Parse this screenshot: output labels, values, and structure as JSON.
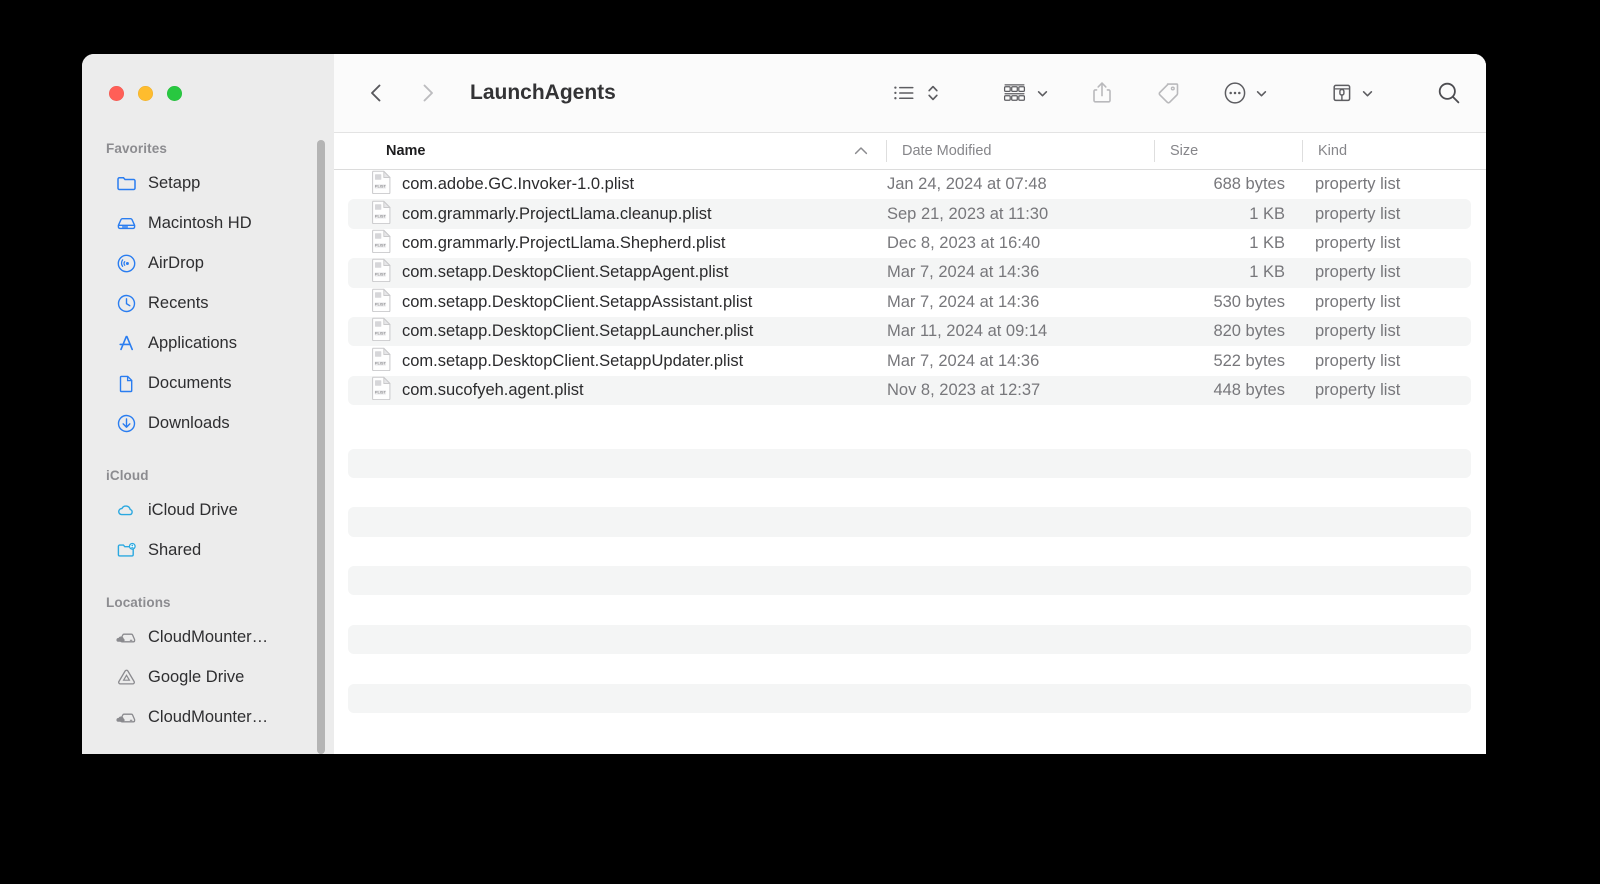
{
  "window": {
    "title": "LaunchAgents",
    "traffic_lights": [
      {
        "name": "close",
        "color": "#ff5f57"
      },
      {
        "name": "minimize",
        "color": "#febc2e"
      },
      {
        "name": "maximize",
        "color": "#28c840"
      }
    ]
  },
  "toolbar": {
    "back_icon": "chevron-left-icon",
    "forward_icon": "chevron-right-icon",
    "items": [
      {
        "name": "view-as-list-icon",
        "label": "View as List"
      },
      {
        "name": "sort-updown-icon",
        "label": "Sort"
      },
      {
        "name": "group-items-icon",
        "label": "Group Items"
      },
      {
        "name": "share-icon",
        "label": "Share"
      },
      {
        "name": "tag-icon",
        "label": "Tags"
      },
      {
        "name": "more-actions-icon",
        "label": "More"
      },
      {
        "name": "setapp-icon",
        "label": "Setapp"
      },
      {
        "name": "search-icon",
        "label": "Search"
      }
    ]
  },
  "sidebar": {
    "sections": [
      {
        "title": "Favorites",
        "items": [
          {
            "label": "Setapp",
            "icon": "folder-icon",
            "color": "#2a7df0"
          },
          {
            "label": "Macintosh HD",
            "icon": "harddisk-icon",
            "color": "#2a7df0"
          },
          {
            "label": "AirDrop",
            "icon": "airdrop-icon",
            "color": "#2a7df0"
          },
          {
            "label": "Recents",
            "icon": "clock-icon",
            "color": "#2a7df0"
          },
          {
            "label": "Applications",
            "icon": "applications-icon",
            "color": "#2a7df0"
          },
          {
            "label": "Documents",
            "icon": "document-icon",
            "color": "#2a7df0"
          },
          {
            "label": "Downloads",
            "icon": "downloads-icon",
            "color": "#2a7df0"
          }
        ]
      },
      {
        "title": "iCloud",
        "items": [
          {
            "label": "iCloud Drive",
            "icon": "cloud-icon",
            "color": "#2ba8e0"
          },
          {
            "label": "Shared",
            "icon": "shared-folder-icon",
            "color": "#2ba8e0"
          }
        ]
      },
      {
        "title": "Locations",
        "items": [
          {
            "label": "CloudMounter…",
            "icon": "cloud-drive-icon",
            "color": "#8a8a8e"
          },
          {
            "label": "Google Drive",
            "icon": "google-drive-icon",
            "color": "#8a8a8e"
          },
          {
            "label": "CloudMounter…",
            "icon": "cloud-drive-icon",
            "color": "#8a8a8e"
          }
        ]
      }
    ]
  },
  "file_table": {
    "columns": [
      {
        "key": "name",
        "label": "Name",
        "sorted": true,
        "sort_direction": "ascending"
      },
      {
        "key": "date",
        "label": "Date Modified",
        "sorted": false
      },
      {
        "key": "size",
        "label": "Size",
        "sorted": false
      },
      {
        "key": "kind",
        "label": "Kind",
        "sorted": false
      }
    ],
    "rows": [
      {
        "name": "com.adobe.GC.Invoker-1.0.plist",
        "date": "Jan 24, 2024 at 07:48",
        "size": "688 bytes",
        "kind": "property list",
        "icon": "plist-file-icon"
      },
      {
        "name": "com.grammarly.ProjectLlama.cleanup.plist",
        "date": "Sep 21, 2023 at 11:30",
        "size": "1 KB",
        "kind": "property list",
        "icon": "plist-file-icon"
      },
      {
        "name": "com.grammarly.ProjectLlama.Shepherd.plist",
        "date": "Dec 8, 2023 at 16:40",
        "size": "1 KB",
        "kind": "property list",
        "icon": "plist-file-icon"
      },
      {
        "name": "com.setapp.DesktopClient.SetappAgent.plist",
        "date": "Mar 7, 2024 at 14:36",
        "size": "1 KB",
        "kind": "property list",
        "icon": "plist-file-icon"
      },
      {
        "name": "com.setapp.DesktopClient.SetappAssistant.plist",
        "date": "Mar 7, 2024 at 14:36",
        "size": "530 bytes",
        "kind": "property list",
        "icon": "plist-file-icon"
      },
      {
        "name": "com.setapp.DesktopClient.SetappLauncher.plist",
        "date": "Mar 11, 2024 at 09:14",
        "size": "820 bytes",
        "kind": "property list",
        "icon": "plist-file-icon"
      },
      {
        "name": "com.setapp.DesktopClient.SetappUpdater.plist",
        "date": "Mar 7, 2024 at 14:36",
        "size": "522 bytes",
        "kind": "property list",
        "icon": "plist-file-icon"
      },
      {
        "name": "com.sucofyeh.agent.plist",
        "date": "Nov 8, 2023 at 12:37",
        "size": "448 bytes",
        "kind": "property list",
        "icon": "plist-file-icon"
      }
    ],
    "empty_row_count": 11
  },
  "colors": {
    "accent_blue": "#2a7df0",
    "sidebar_bg": "#ececec",
    "toolbar_bg": "#fbfbfb",
    "row_alt_bg": "#f4f5f5",
    "desktop_bg": "#000000"
  }
}
